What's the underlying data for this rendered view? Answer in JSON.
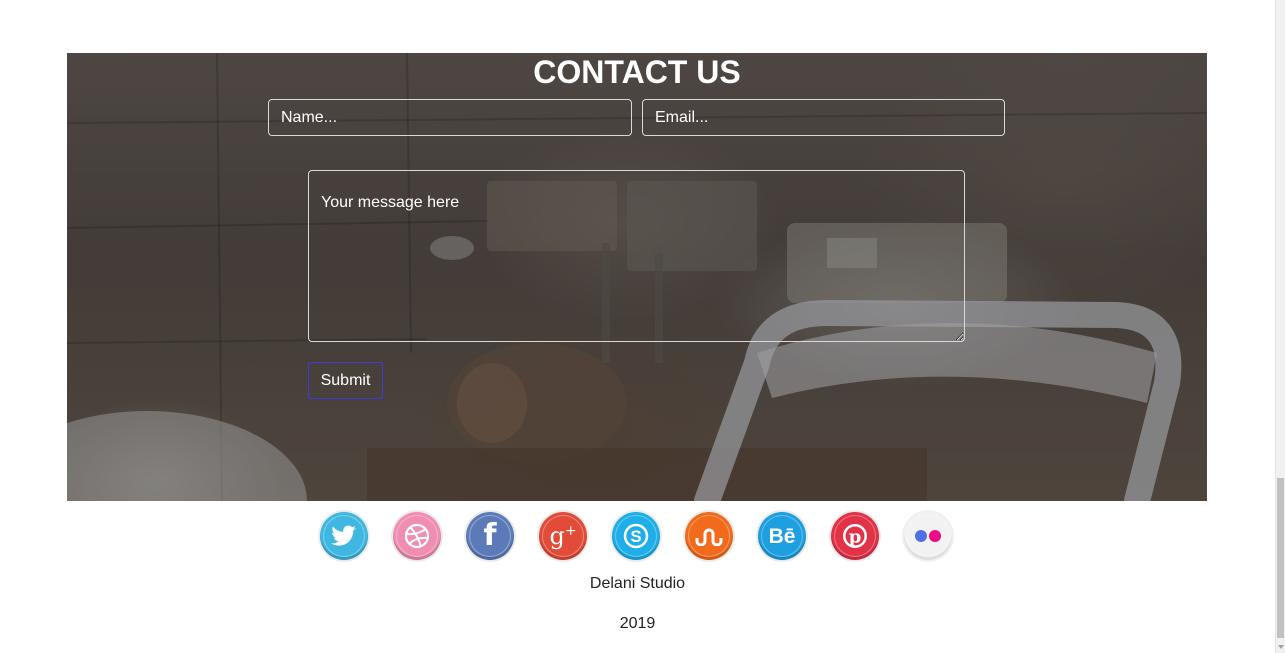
{
  "contact": {
    "title": "CONTACT US",
    "name_placeholder": "Name...",
    "email_placeholder": "Email...",
    "message_placeholder": "Your message here",
    "submit_label": "Submit"
  },
  "social": {
    "items": [
      {
        "name": "twitter-icon",
        "color": "#3fb7e0"
      },
      {
        "name": "dribbble-icon",
        "color": "#ef8db3"
      },
      {
        "name": "facebook-icon",
        "color": "#5d7ab8"
      },
      {
        "name": "google-plus-icon",
        "color": "#e14b37"
      },
      {
        "name": "skype-icon",
        "color": "#1eaee8"
      },
      {
        "name": "stumbleupon-icon",
        "color": "#f26a1b"
      },
      {
        "name": "behance-icon",
        "color": "#1e9fe0"
      },
      {
        "name": "pinterest-icon",
        "color": "#e23248"
      },
      {
        "name": "flickr-icon",
        "color": "#f2f2f2"
      }
    ]
  },
  "footer": {
    "studio": "Delani Studio",
    "year": "2019"
  }
}
